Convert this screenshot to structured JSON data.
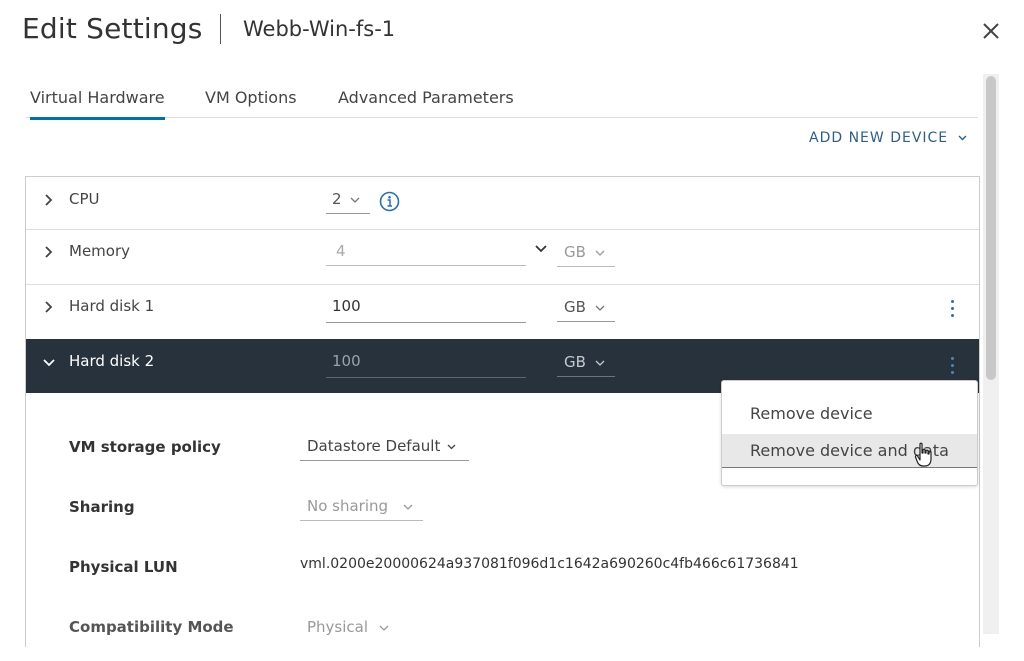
{
  "dialog": {
    "title": "Edit Settings",
    "vm_name": "Webb-Win-fs-1"
  },
  "tabs": [
    {
      "label": "Virtual Hardware",
      "active": true
    },
    {
      "label": "VM Options",
      "active": false
    },
    {
      "label": "Advanced Parameters",
      "active": false
    }
  ],
  "toolbar": {
    "add_new_device": "ADD NEW DEVICE"
  },
  "devices": {
    "cpu": {
      "label": "CPU",
      "value": "2"
    },
    "memory": {
      "label": "Memory",
      "value": "4",
      "unit": "GB"
    },
    "hard_disk_1": {
      "label": "Hard disk 1",
      "value": "100",
      "unit": "GB"
    },
    "hard_disk_2": {
      "label": "Hard disk 2",
      "value": "100",
      "unit": "GB",
      "properties": {
        "storage_policy": {
          "label": "VM storage policy",
          "value": "Datastore Default"
        },
        "sharing": {
          "label": "Sharing",
          "value": "No sharing"
        },
        "physical_lun": {
          "label": "Physical LUN",
          "value": "vml.0200e20000624a937081f096d1c1642a690260c4fb466c61736841"
        },
        "compatibility_mode": {
          "label": "Compatibility Mode",
          "value": "Physical"
        }
      }
    }
  },
  "context_menu": {
    "items": [
      "Remove device",
      "Remove device and data"
    ]
  },
  "colors": {
    "accent": "#0072a3",
    "link": "#2f5f87",
    "expanded_row": "#27323c",
    "menu_hover": "#e8e8e8"
  },
  "icons": {
    "close": "close-icon",
    "info": "info-icon",
    "expand": "chevron-right-icon",
    "collapse": "chevron-down-icon",
    "more": "kebab-menu-icon",
    "cursor": "hand-pointer-icon"
  }
}
